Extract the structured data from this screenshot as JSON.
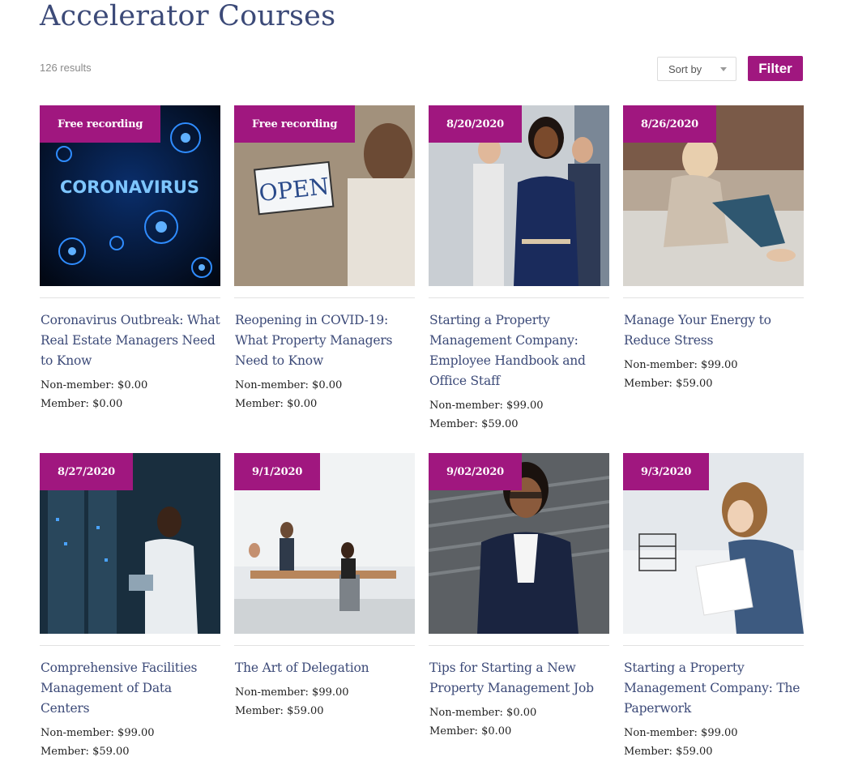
{
  "page": {
    "title": "Accelerator Courses",
    "results": "126 results"
  },
  "toolbar": {
    "sort_label": "Sort by",
    "filter_label": "Filter"
  },
  "colors": {
    "accent": "#a0177f",
    "title": "#3c4a78"
  },
  "courses": [
    {
      "badge": "Free recording",
      "title": "Coronavirus Outbreak: What Real Estate Managers Need to Know",
      "nonmember": "Non-member: $0.00",
      "member": "Member: $0.00",
      "image": "coronavirus-image"
    },
    {
      "badge": "Free recording",
      "title": "Reopening in COVID-19: What Property Managers Need to Know",
      "nonmember": "Non-member: $0.00",
      "member": "Member: $0.00",
      "image": "open-sign-image",
      "image_text": "OPEN"
    },
    {
      "badge": "8/20/2020",
      "title": "Starting a Property Management Company: Employee Handbook and Office Staff",
      "nonmember": "Non-member: $99.00",
      "member": "Member: $59.00",
      "image": "team-photo-image"
    },
    {
      "badge": "8/26/2020",
      "title": "Manage Your Energy to Reduce Stress",
      "nonmember": "Non-member: $99.00",
      "member": "Member: $59.00",
      "image": "relaxing-woman-image"
    },
    {
      "badge": "8/27/2020",
      "title": "Comprehensive Facilities Management of Data Centers",
      "nonmember": "Non-member: $99.00",
      "member": "Member: $59.00",
      "image": "data-center-image"
    },
    {
      "badge": "9/1/2020",
      "title": "The Art of Delegation",
      "nonmember": "Non-member: $99.00",
      "member": "Member: $59.00",
      "image": "office-meeting-image"
    },
    {
      "badge": "9/02/2020",
      "title": "Tips for Starting a New Property Management Job",
      "nonmember": "Non-member: $0.00",
      "member": "Member: $0.00",
      "image": "professional-woman-image"
    },
    {
      "badge": "9/3/2020",
      "title": "Starting a Property Management Company: The Paperwork",
      "nonmember": "Non-member: $99.00",
      "member": "Member: $59.00",
      "image": "paperwork-image"
    }
  ]
}
